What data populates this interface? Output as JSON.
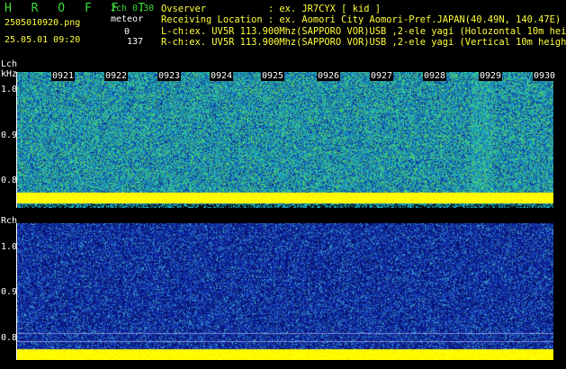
{
  "app": {
    "title": "HROFFT",
    "filename": "2505010920.png",
    "timestamp": "25.05.01 09:20",
    "mode": "2ch 0.30",
    "meteor_label": "meteor",
    "count_l": "0",
    "count_r": "137"
  },
  "header": {
    "observer": "Ovserver           : ex. JR7CYX [ kid ]",
    "location": "Receiving Location : ex. Aomori City Aomori-Pref.JAPAN(40.49N, 140.47E)",
    "lch": "L-ch:ex. UV5R 113.900Mhz(SAPPORO VOR)USB ,2-ele yagi (Holozontal 10m height)",
    "rch": "R-ch:ex. UV5R 113.900Mhz(SAPPORO VOR)USB ,2-ele yagi (Vertical 10m height)"
  },
  "left_panel": {
    "label": "Lch",
    "unit": "kHz",
    "ticks": [
      "1.0",
      "0.9",
      "0.8"
    ],
    "time_marks": [
      "0921",
      "0922",
      "0923",
      "0924",
      "0925",
      "0926",
      "0927",
      "0928",
      "0929",
      "0930"
    ]
  },
  "right_panel": {
    "label": "Rch",
    "ticks": [
      "1.0",
      "0.9",
      "0.8"
    ]
  },
  "colors": {
    "background": "#000000",
    "label_yellow": "#ffff3c",
    "label_green": "#3cdc3c",
    "signal_band": "#ffff00"
  }
}
